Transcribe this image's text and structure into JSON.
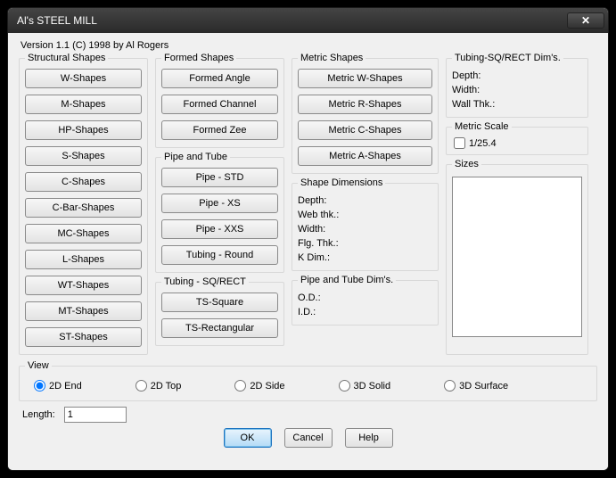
{
  "window": {
    "title": "Al's STEEL MILL"
  },
  "version": "Version 1.1 (C) 1998 by Al Rogers",
  "groups": {
    "structural": {
      "legend": "Structural Shapes",
      "buttons": [
        "W-Shapes",
        "M-Shapes",
        "HP-Shapes",
        "S-Shapes",
        "C-Shapes",
        "C-Bar-Shapes",
        "MC-Shapes",
        "L-Shapes",
        "WT-Shapes",
        "MT-Shapes",
        "ST-Shapes"
      ]
    },
    "formed": {
      "legend": "Formed Shapes",
      "buttons": [
        "Formed Angle",
        "Formed Channel",
        "Formed Zee"
      ]
    },
    "pipe": {
      "legend": "Pipe and Tube",
      "buttons": [
        "Pipe - STD",
        "Pipe - XS",
        "Pipe - XXS",
        "Tubing - Round"
      ]
    },
    "tubing": {
      "legend": "Tubing - SQ/RECT",
      "buttons": [
        "TS-Square",
        "TS-Rectangular"
      ]
    },
    "metric": {
      "legend": "Metric Shapes",
      "buttons": [
        "Metric W-Shapes",
        "Metric R-Shapes",
        "Metric C-Shapes",
        "Metric A-Shapes"
      ]
    },
    "shapeDims": {
      "legend": "Shape Dimensions",
      "rows": {
        "depth": "Depth:",
        "web": "Web thk.:",
        "width": "Width:",
        "flg": "Flg. Thk.:",
        "k": "K Dim.:"
      }
    },
    "pipeDims": {
      "legend": "Pipe and Tube Dim's.",
      "rows": {
        "od": "O.D.:",
        "id": "I.D.:"
      }
    },
    "tubingDims": {
      "legend": "Tubing-SQ/RECT Dim's.",
      "rows": {
        "depth": "Depth:",
        "width": "Width:",
        "wall": "Wall Thk.:"
      }
    },
    "metricScale": {
      "legend": "Metric Scale",
      "check": "1/25.4"
    },
    "sizes": {
      "legend": "Sizes"
    }
  },
  "view": {
    "legend": "View",
    "options": [
      "2D End",
      "2D Top",
      "2D Side",
      "3D Solid",
      "3D Surface"
    ],
    "selected": "2D End"
  },
  "length": {
    "label": "Length:",
    "value": "1"
  },
  "footer": {
    "ok": "OK",
    "cancel": "Cancel",
    "help": "Help"
  }
}
